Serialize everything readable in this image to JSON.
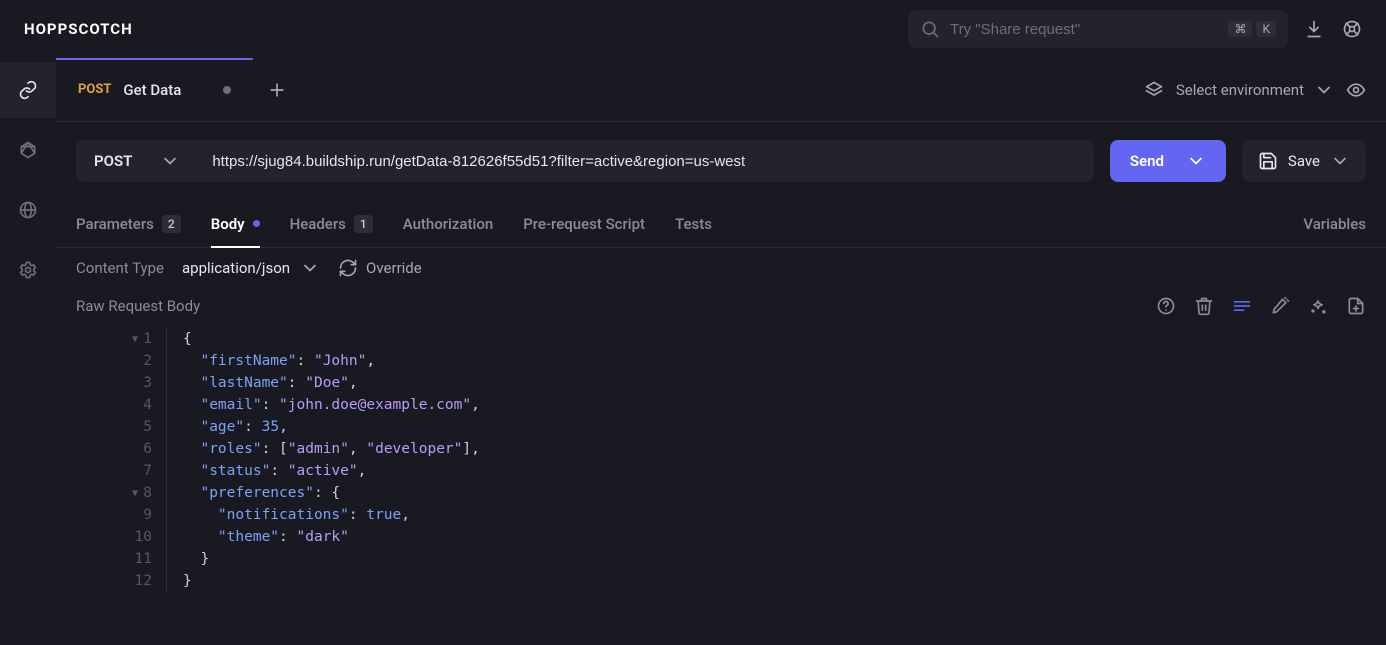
{
  "app": {
    "name": "HOPPSCOTCH"
  },
  "search": {
    "placeholder": "Try \"Share request\"",
    "kbd_mod": "⌘",
    "kbd_key": "K"
  },
  "rail": {
    "items": [
      "rest",
      "graphql",
      "realtime",
      "settings"
    ],
    "active": 0
  },
  "tabs": {
    "items": [
      {
        "method": "POST",
        "title": "Get Data",
        "dirty": true
      }
    ],
    "env_label": "Select environment"
  },
  "request": {
    "method": "POST",
    "url": "https://sjug84.buildship.run/getData-812626f55d51?filter=active&region=us-west",
    "send_label": "Send",
    "save_label": "Save"
  },
  "sections": {
    "parameters": {
      "label": "Parameters",
      "count": "2"
    },
    "body": {
      "label": "Body",
      "active": true,
      "dot": true
    },
    "headers": {
      "label": "Headers",
      "count": "1"
    },
    "auth": {
      "label": "Authorization"
    },
    "prerequest": {
      "label": "Pre-request Script"
    },
    "tests": {
      "label": "Tests"
    },
    "variables": {
      "label": "Variables"
    }
  },
  "contentType": {
    "label": "Content Type",
    "value": "application/json",
    "override": "Override"
  },
  "body": {
    "title": "Raw Request Body",
    "lines": [
      {
        "n": "1",
        "fold": "▼",
        "tokens": [
          [
            "punc",
            "{"
          ]
        ]
      },
      {
        "n": "2",
        "tokens": [
          [
            "ind",
            "  "
          ],
          [
            "key",
            "\"firstName\""
          ],
          [
            "punc",
            ": "
          ],
          [
            "str",
            "\"John\""
          ],
          [
            "punc",
            ","
          ]
        ]
      },
      {
        "n": "3",
        "tokens": [
          [
            "ind",
            "  "
          ],
          [
            "key",
            "\"lastName\""
          ],
          [
            "punc",
            ": "
          ],
          [
            "str",
            "\"Doe\""
          ],
          [
            "punc",
            ","
          ]
        ]
      },
      {
        "n": "4",
        "tokens": [
          [
            "ind",
            "  "
          ],
          [
            "key",
            "\"email\""
          ],
          [
            "punc",
            ": "
          ],
          [
            "str",
            "\"john.doe@example.com\""
          ],
          [
            "punc",
            ","
          ]
        ]
      },
      {
        "n": "5",
        "tokens": [
          [
            "ind",
            "  "
          ],
          [
            "key",
            "\"age\""
          ],
          [
            "punc",
            ": "
          ],
          [
            "num",
            "35"
          ],
          [
            "punc",
            ","
          ]
        ]
      },
      {
        "n": "6",
        "tokens": [
          [
            "ind",
            "  "
          ],
          [
            "key",
            "\"roles\""
          ],
          [
            "punc",
            ": ["
          ],
          [
            "str",
            "\"admin\""
          ],
          [
            "punc",
            ", "
          ],
          [
            "str",
            "\"developer\""
          ],
          [
            "punc",
            "],"
          ]
        ]
      },
      {
        "n": "7",
        "tokens": [
          [
            "ind",
            "  "
          ],
          [
            "key",
            "\"status\""
          ],
          [
            "punc",
            ": "
          ],
          [
            "str",
            "\"active\""
          ],
          [
            "punc",
            ","
          ]
        ]
      },
      {
        "n": "8",
        "fold": "▼",
        "tokens": [
          [
            "ind",
            "  "
          ],
          [
            "key",
            "\"preferences\""
          ],
          [
            "punc",
            ": {"
          ]
        ]
      },
      {
        "n": "9",
        "tokens": [
          [
            "ind",
            "    "
          ],
          [
            "key",
            "\"notifications\""
          ],
          [
            "punc",
            ": "
          ],
          [
            "bool",
            "true"
          ],
          [
            "punc",
            ","
          ]
        ]
      },
      {
        "n": "10",
        "tokens": [
          [
            "ind",
            "    "
          ],
          [
            "key",
            "\"theme\""
          ],
          [
            "punc",
            ": "
          ],
          [
            "str",
            "\"dark\""
          ]
        ]
      },
      {
        "n": "11",
        "tokens": [
          [
            "ind",
            "  "
          ],
          [
            "punc",
            "}"
          ]
        ]
      },
      {
        "n": "12",
        "tokens": [
          [
            "punc",
            "}"
          ]
        ]
      }
    ]
  }
}
